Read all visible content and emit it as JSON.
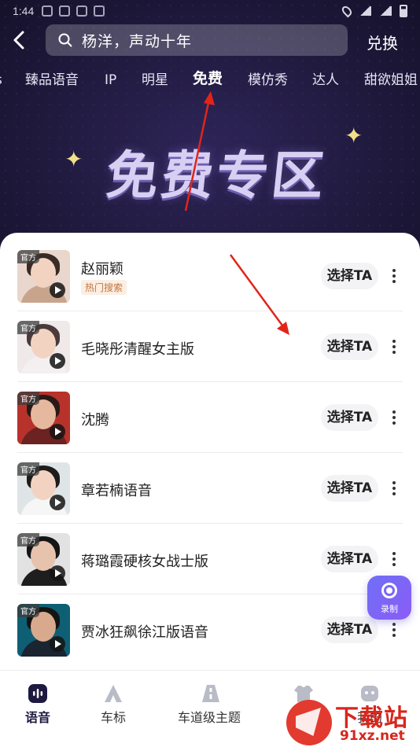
{
  "status_bar": {
    "time": "1:44"
  },
  "header": {
    "search_text": "杨洋，声动十年",
    "redeem_label": "兑换"
  },
  "tabs": [
    {
      "label": "臻品语音"
    },
    {
      "label": "IP"
    },
    {
      "label": "明星"
    },
    {
      "label": "免费",
      "active": true
    },
    {
      "label": "模仿秀"
    },
    {
      "label": "达人"
    },
    {
      "label": "甜欲姐姐"
    }
  ],
  "banner": {
    "title": "免费专区"
  },
  "voices": [
    {
      "official": "官方",
      "name": "赵丽颖",
      "badge": "热门搜索",
      "select": "选择TA"
    },
    {
      "official": "官方",
      "name": "毛晓彤清醒女主版",
      "select": "选择TA"
    },
    {
      "official": "官方",
      "name": "沈腾",
      "select": "选择TA"
    },
    {
      "official": "官方",
      "name": "章若楠语音",
      "select": "选择TA"
    },
    {
      "official": "官方",
      "name": "蒋璐霞硬核女战士版",
      "select": "选择TA"
    },
    {
      "official": "官方",
      "name": "贾冰狂飙徐江版语音",
      "select": "选择TA"
    }
  ],
  "record_fab": {
    "label": "录制"
  },
  "bottom_nav": [
    {
      "label": "语音",
      "active": true,
      "icon": "voice-icon"
    },
    {
      "label": "车标",
      "icon": "car-logo-icon"
    },
    {
      "label": "车道级主题",
      "icon": "lane-theme-icon"
    },
    {
      "label": "皮肤",
      "icon": "skin-icon"
    },
    {
      "label": "我的",
      "icon": "profile-icon"
    }
  ],
  "watermark": {
    "big": "下载站",
    "small": "91xz.net"
  },
  "colors": {
    "hero_bg": "#201a3e",
    "accent": "#7c6cf2",
    "badge_text": "#c0763f",
    "annotation_arrow": "#e0251b"
  }
}
